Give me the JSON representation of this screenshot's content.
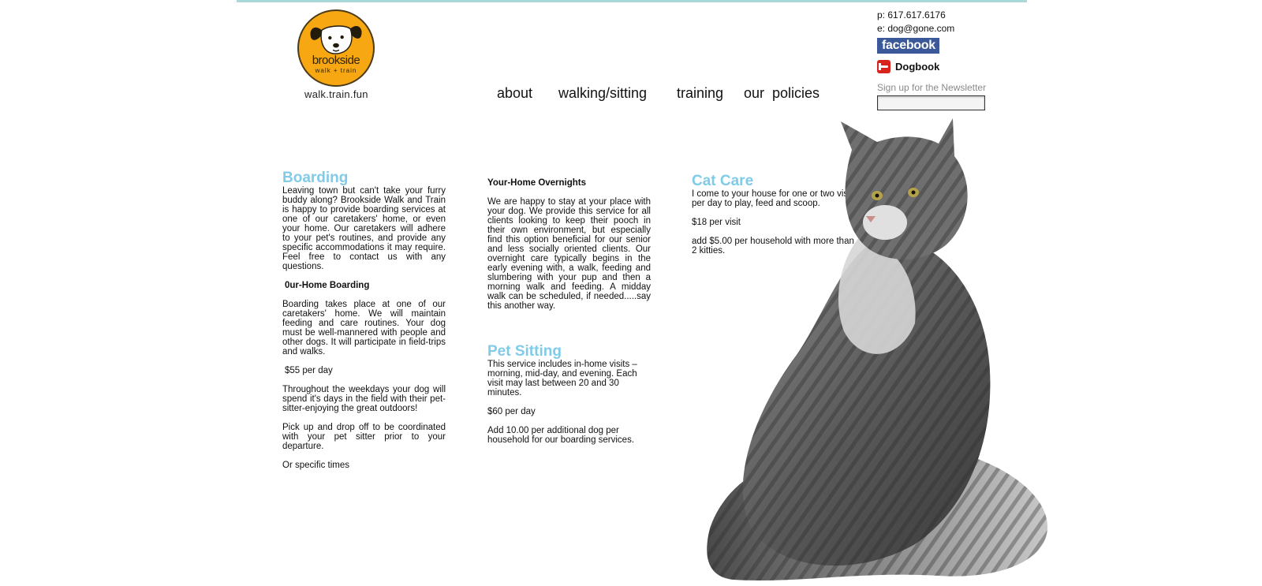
{
  "header": {
    "logo_name": "brookside",
    "logo_sub": "walk + train",
    "tagline": "walk.train.fun"
  },
  "nav": {
    "items": [
      "about",
      "walking/sitting",
      "training",
      "our  policies"
    ]
  },
  "contact": {
    "phone": "p: 617.617.6176",
    "email": "e: dog@gone.com",
    "facebook": "facebook",
    "dogbook": "Dogbook",
    "newsletter_label": "Sign up for the Newsletter",
    "newsletter_value": ""
  },
  "boarding": {
    "title": "Boarding",
    "intro": "Leaving town but can't take your furry buddy along? Brookside Walk and Train is happy to provide boarding services at one of our caretakers' home, or even your home. Our caretakers will adhere to your pet's routines, and provide any specific accommodations it may require. Feel free to contact us with any questions.",
    "subheading": "0ur-Home Boarding",
    "desc": "Boarding takes place at one of our caretakers' home. We will maintain feeding and care routines. Your dog must be well-mannered with people and other dogs. It will participate in field-trips and walks.",
    "price": "$55 per day",
    "weekdays": "Throughout the weekdays your dog will spend it's days in the field with their pet-sitter-enjoying the great outdoors!",
    "pickup": "Pick up and drop off to be coordinated with your pet sitter prior to your departure.",
    "times": "Or specific times"
  },
  "overnights": {
    "title": "Your-Home Overnights",
    "desc": "We are happy to stay at your place with your dog. We provide this service for all clients looking to keep their pooch in their own environment, but especially find this option beneficial for our senior and less socially oriented clients. Our overnight care typically begins in the early evening with, a walk, feeding and slumbering with your pup and then a morning walk and feeding.  A midday walk can be scheduled, if needed.....say this another way."
  },
  "petsitting": {
    "title": "Pet Sitting",
    "desc": "This service includes in-home visits – morning, mid-day, and evening. Each visit may last between 20 and 30 minutes.",
    "price": "$60 per day",
    "extra": "Add 10.00 per additional dog per household for our boarding services."
  },
  "catcare": {
    "title": "Cat Care",
    "desc": "I come to your house for one or two visits per day to play, feed and scoop.",
    "price": "$18 per visit",
    "extra": "add $5.00 per household with more than 2 kitties."
  }
}
